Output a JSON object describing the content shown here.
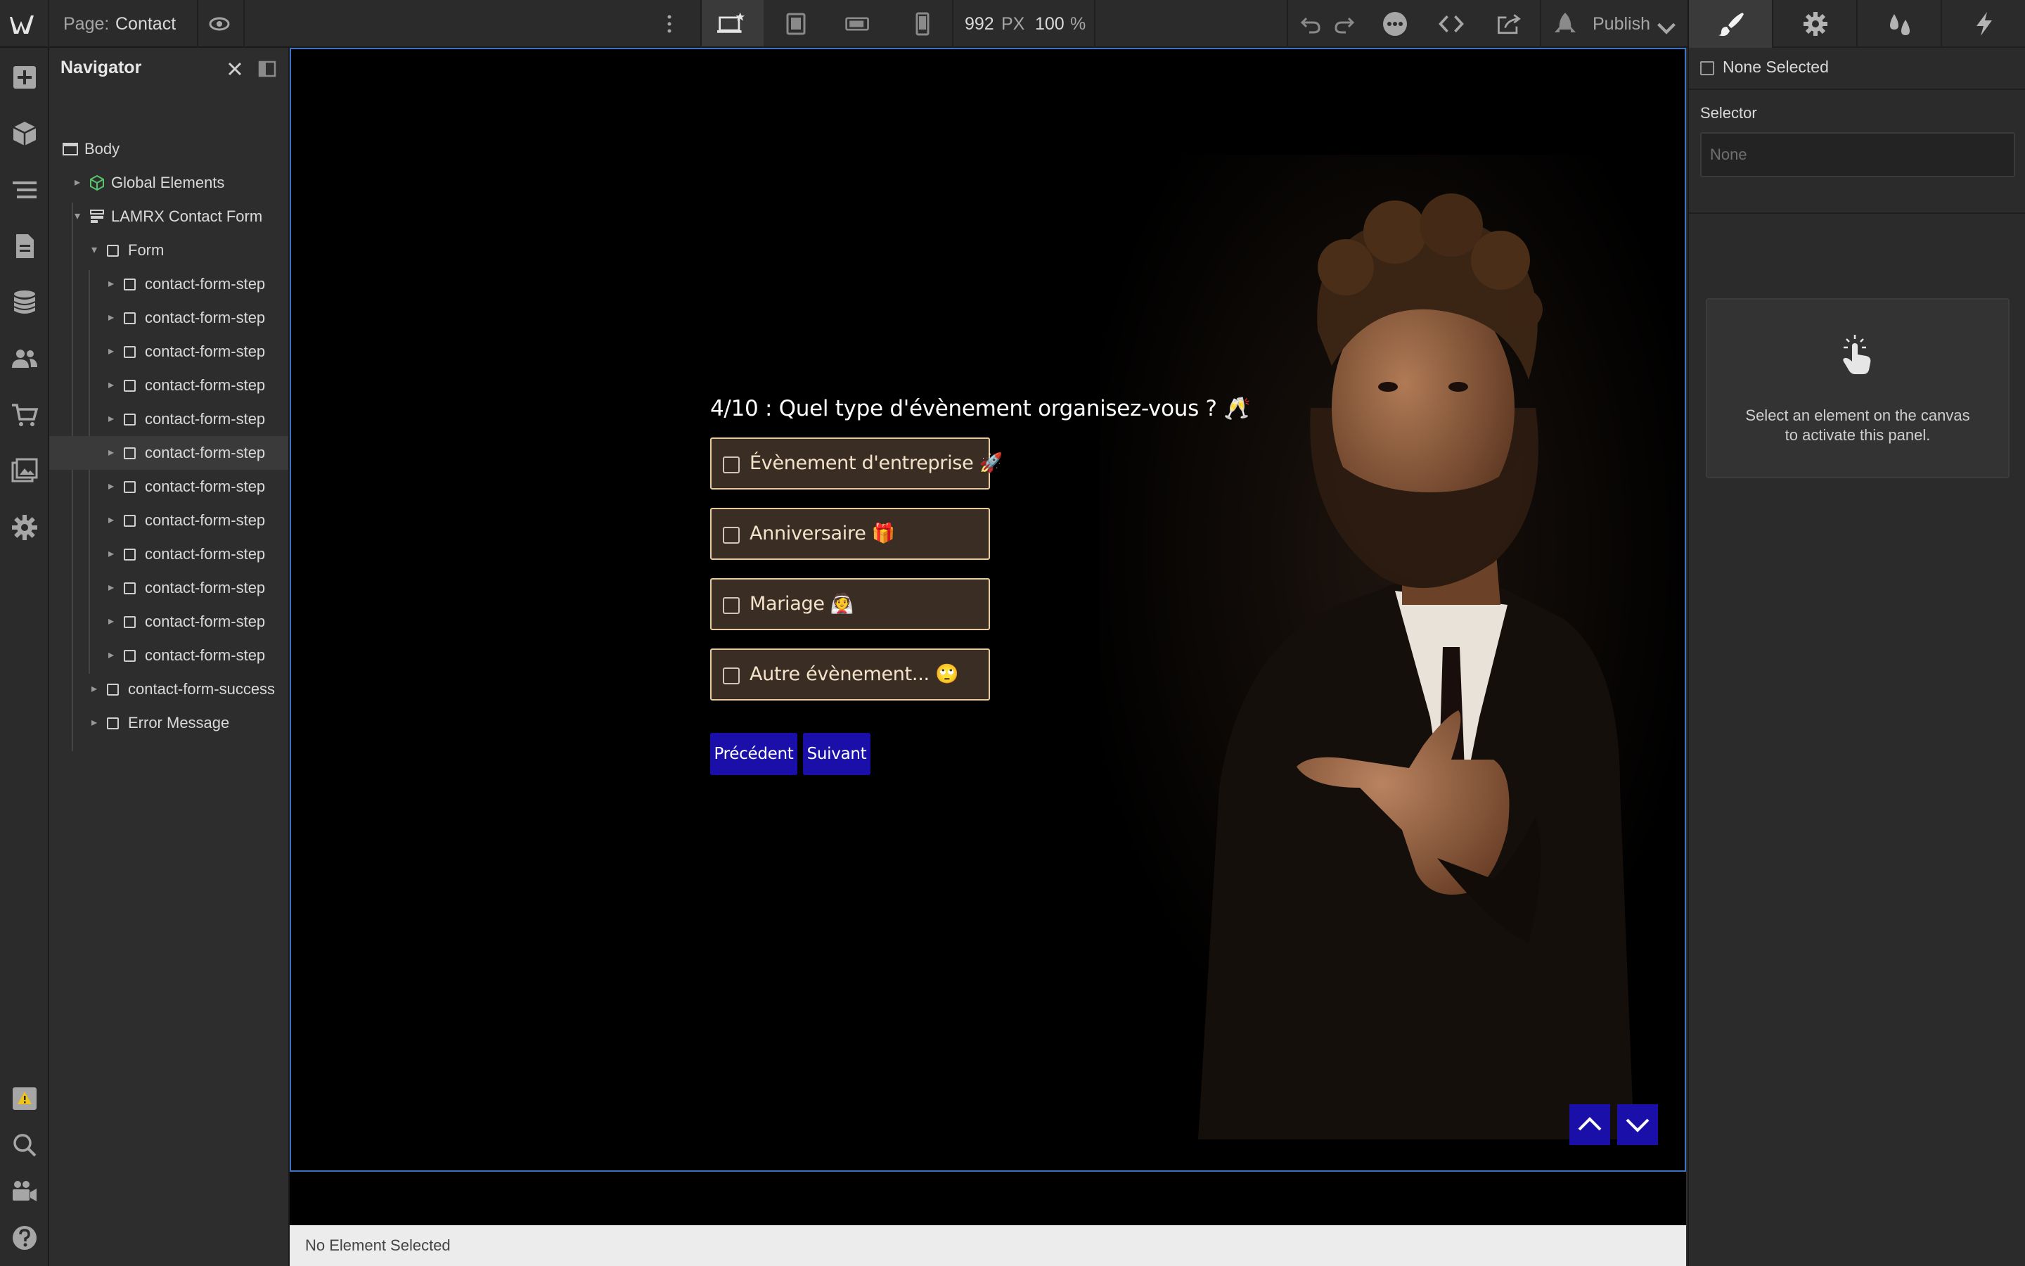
{
  "topbar": {
    "page_prefix": "Page:",
    "page_name": "Contact",
    "width_value": "992",
    "width_unit": "PX",
    "zoom_value": "100",
    "zoom_unit": "%",
    "publish_label": "Publish",
    "icons": [
      "webflow-logo-icon",
      "eye-icon",
      "more-vertical-icon",
      "desktop-star-icon",
      "tablet-icon",
      "mobile-landscape-icon",
      "mobile-portrait-icon",
      "undo-icon",
      "redo-icon",
      "more-options-icon",
      "code-icon",
      "export-icon",
      "publish-rocket-icon",
      "chevron-down-icon"
    ]
  },
  "rail": {
    "icons": [
      "add-icon",
      "components-icon",
      "navigator-icon",
      "pages-icon",
      "cms-icon",
      "users-icon",
      "ecommerce-icon",
      "assets-icon",
      "settings-icon",
      "audit-icon",
      "search-icon",
      "video-icon",
      "help-icon"
    ]
  },
  "navigator": {
    "title": "Navigator",
    "items": [
      {
        "label": "Body"
      },
      {
        "label": "Global Elements"
      },
      {
        "label": "LAMRX Contact Form"
      },
      {
        "label": "Form"
      },
      {
        "label": "contact-form-step"
      },
      {
        "label": "contact-form-step"
      },
      {
        "label": "contact-form-step"
      },
      {
        "label": "contact-form-step"
      },
      {
        "label": "contact-form-step"
      },
      {
        "label": "contact-form-step"
      },
      {
        "label": "contact-form-step"
      },
      {
        "label": "contact-form-step"
      },
      {
        "label": "contact-form-step"
      },
      {
        "label": "contact-form-step"
      },
      {
        "label": "contact-form-step"
      },
      {
        "label": "contact-form-step"
      },
      {
        "label": "contact-form-success"
      },
      {
        "label": "Error Message"
      }
    ]
  },
  "canvas": {
    "question": "4/10 : Quel type d'évènement organisez-vous ? 🥂",
    "options": [
      {
        "label": "Évènement d'entreprise 🚀"
      },
      {
        "label": "Anniversaire 🎁"
      },
      {
        "label": "Mariage 👰"
      },
      {
        "label": "Autre évènement... 🙄"
      }
    ],
    "prev_button": "Précédent",
    "next_button": "Suivant",
    "status": "No Element Selected"
  },
  "rightpanel": {
    "tabs": [
      "style-brush-icon",
      "settings-gear-icon",
      "interactions-drops-icon",
      "lightning-icon"
    ],
    "none_selected": "None Selected",
    "selector_label": "Selector",
    "selector_placeholder": "None",
    "empty_message_line1": "Select an element on the canvas",
    "empty_message_line2": "to activate this panel."
  },
  "colors": {
    "accent_blue": "#1a0fa8",
    "option_border": "#e8c9a0",
    "option_fill": "#3a2e24",
    "canvas_border": "#3d72c4"
  }
}
